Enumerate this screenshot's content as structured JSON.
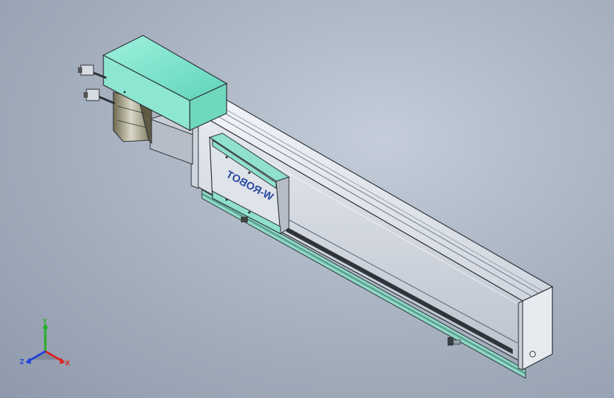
{
  "viewport": {
    "background_top": "#c4cdd9",
    "background_bottom": "#8e9aab"
  },
  "model": {
    "brand_text": "W-ROBOT",
    "accent_color": "#7fe5cf",
    "body_color": "#dfe3ea",
    "edge_color": "#2a2f36"
  },
  "triad": {
    "x_label": "X",
    "y_label": "Y",
    "z_label": "Z",
    "x_color": "#e02020",
    "y_color": "#20b020",
    "z_color": "#2040e0"
  }
}
